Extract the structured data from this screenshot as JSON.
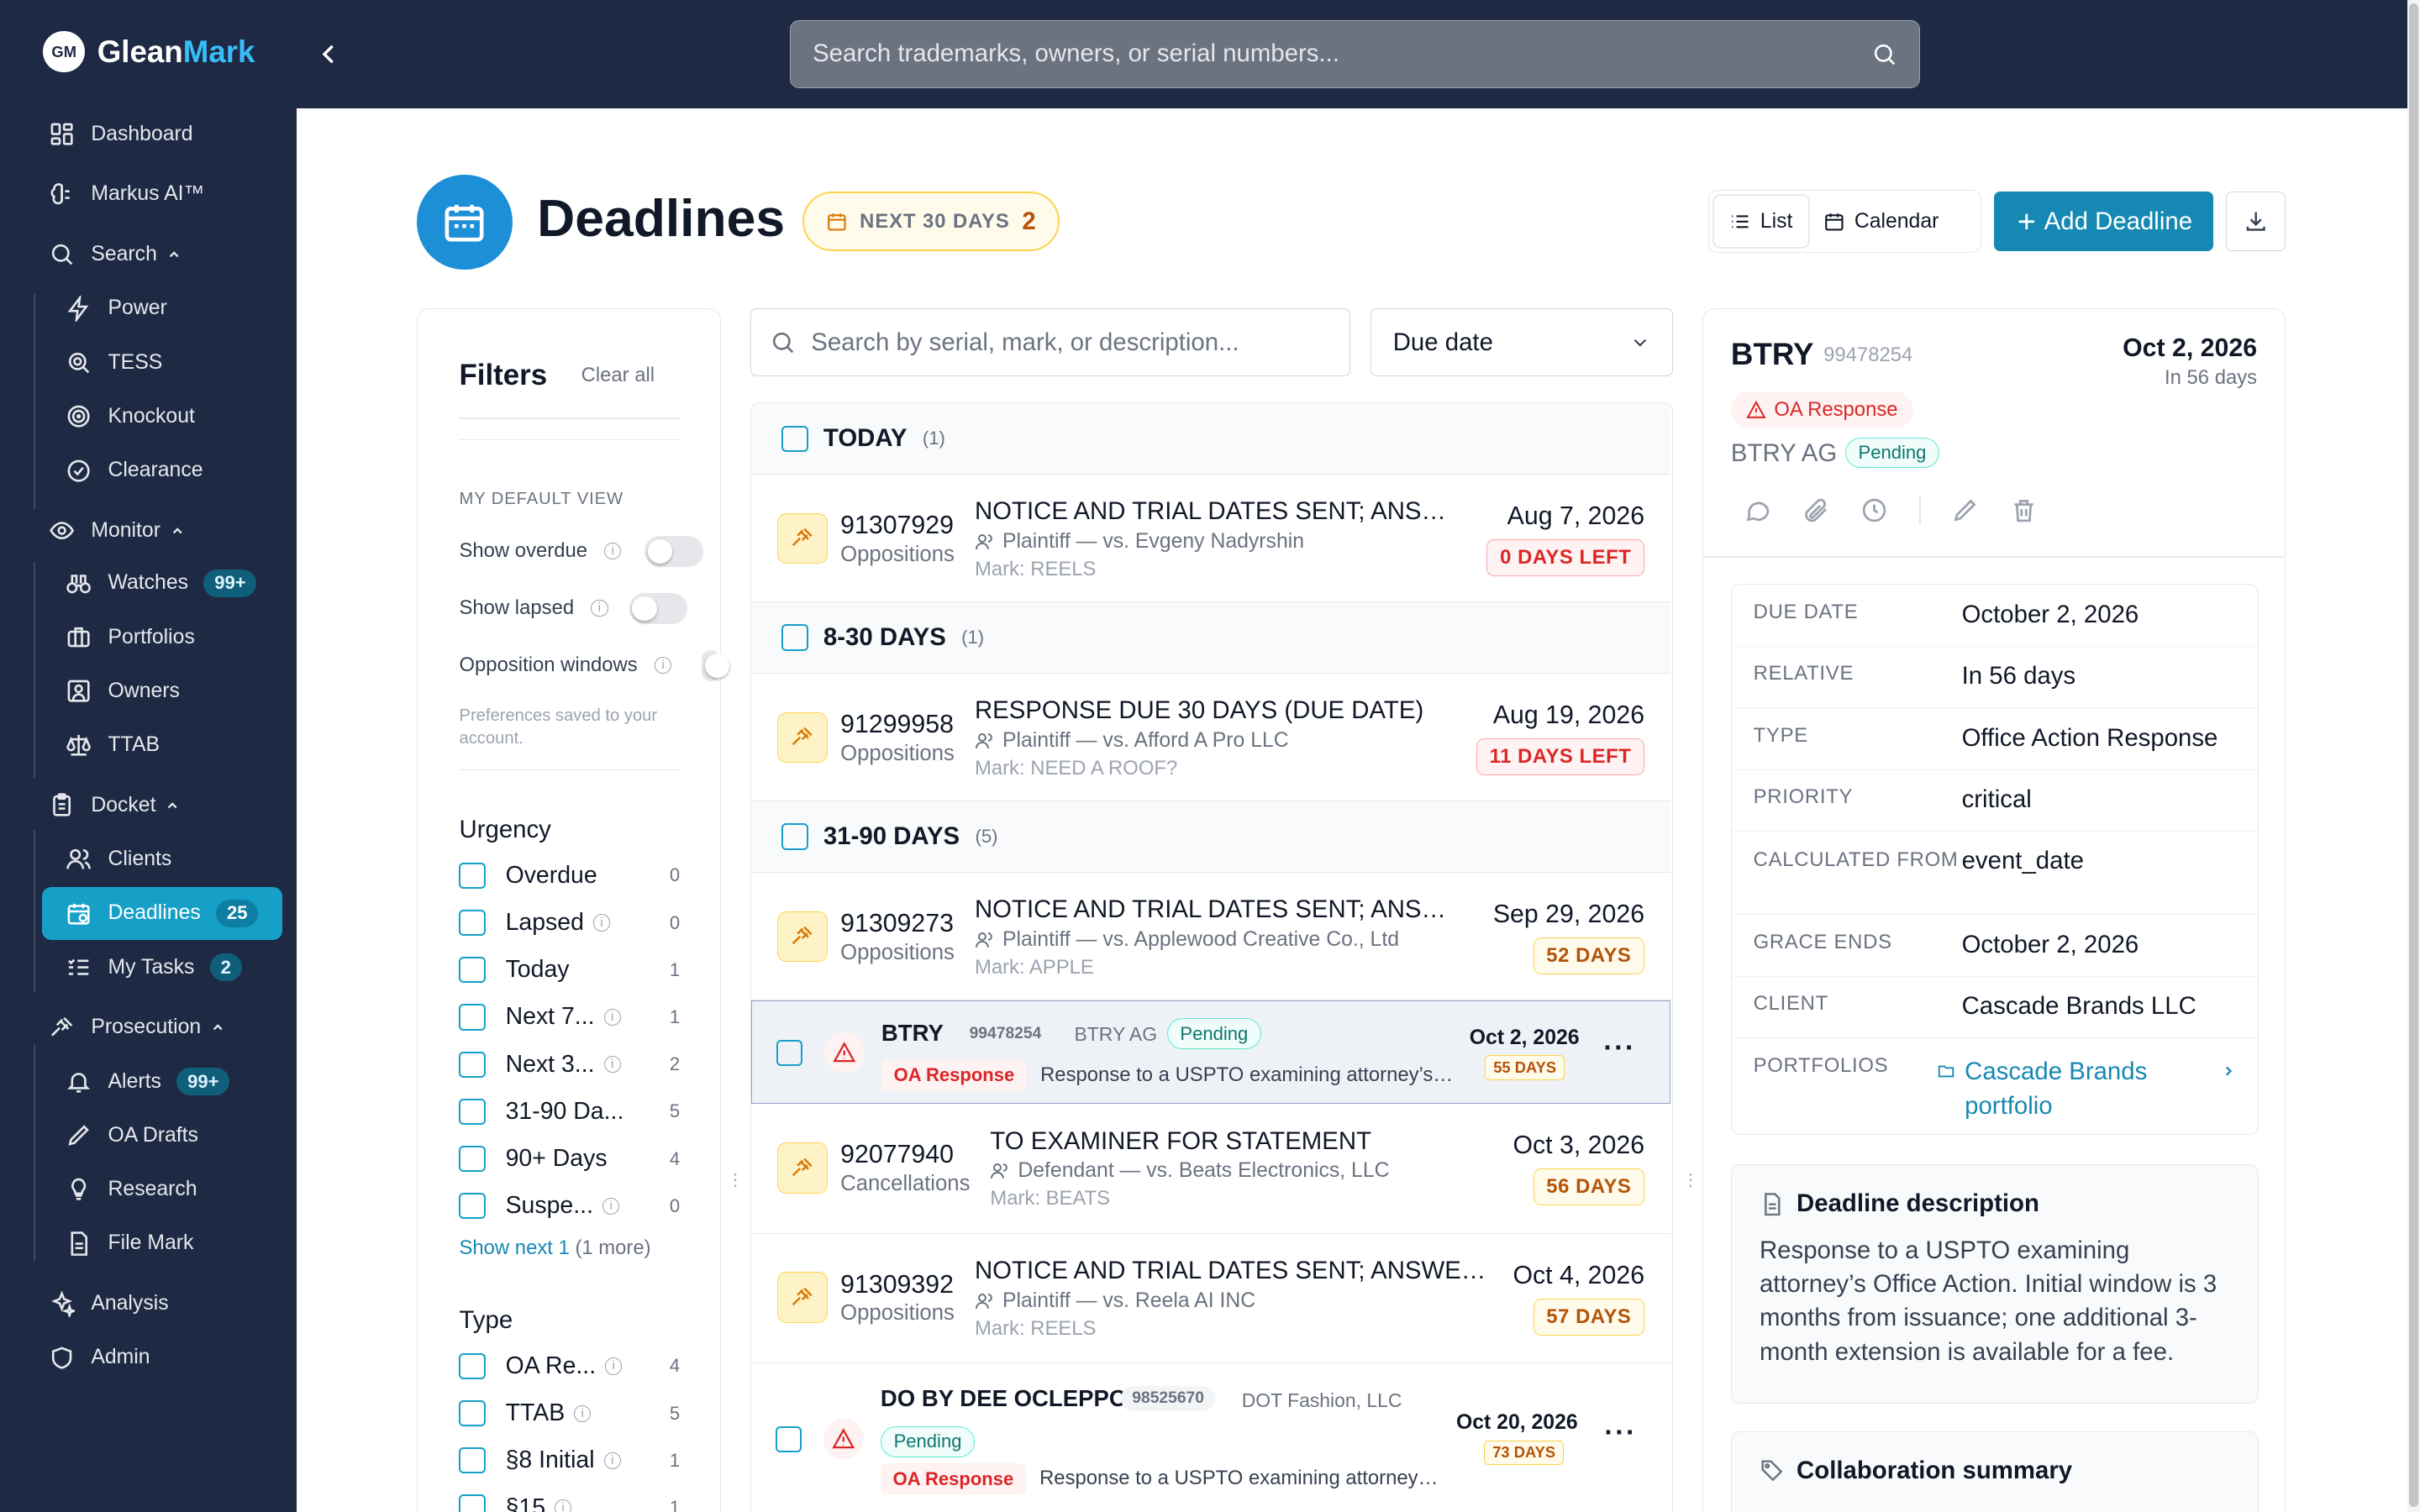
{
  "app": {
    "logo_initials": "GM",
    "brand_a": "Glean",
    "brand_b": "Mark"
  },
  "topbar": {
    "search_placeholder": "Search trademarks, owners, or serial numbers..."
  },
  "sidebar": {
    "dashboard": "Dashboard",
    "markus": "Markus AI™",
    "search": "Search",
    "power": "Power",
    "tess": "TESS",
    "knockout": "Knockout",
    "clearance": "Clearance",
    "monitor": "Monitor",
    "watches": "Watches",
    "watches_badge": "99+",
    "portfolios": "Portfolios",
    "owners": "Owners",
    "ttab": "TTAB",
    "docket": "Docket",
    "clients": "Clients",
    "deadlines": "Deadlines",
    "deadlines_badge": "25",
    "mytasks": "My Tasks",
    "mytasks_badge": "2",
    "prosecution": "Prosecution",
    "alerts": "Alerts",
    "alerts_badge": "99+",
    "oadrafts": "OA Drafts",
    "research": "Research",
    "filemark": "File Mark",
    "analysis": "Analysis",
    "admin": "Admin"
  },
  "header": {
    "title": "Deadlines",
    "range_label": "NEXT 30 DAYS",
    "range_count": "2",
    "list_label": "List",
    "calendar_label": "Calendar",
    "add_label": "Add Deadline"
  },
  "filters": {
    "title": "Filters",
    "clear": "Clear all",
    "default_view": "MY DEFAULT VIEW",
    "show_overdue": "Show overdue",
    "show_lapsed": "Show lapsed",
    "opposition_windows": "Opposition windows",
    "saved_note": "Preferences saved to your account.",
    "urgency_title": "Urgency",
    "urgency": [
      {
        "label": "Overdue",
        "count": "0"
      },
      {
        "label": "Lapsed",
        "count": "0"
      },
      {
        "label": "Today",
        "count": "1"
      },
      {
        "label": "Next 7...",
        "count": "1"
      },
      {
        "label": "Next 3...",
        "count": "2"
      },
      {
        "label": "31-90 Da...",
        "count": "5"
      },
      {
        "label": "90+ Days",
        "count": "4"
      },
      {
        "label": "Suspe...",
        "count": "0"
      }
    ],
    "show_next": "Show next 1",
    "show_more": "(1 more)",
    "type_title": "Type",
    "types": [
      {
        "label": "OA Re...",
        "count": "4"
      },
      {
        "label": "TTAB",
        "count": "5"
      },
      {
        "label": "§8 Initial",
        "count": "1"
      },
      {
        "label": "§15",
        "count": "1"
      }
    ]
  },
  "list": {
    "search_placeholder": "Search by serial, mark, or description...",
    "sort_value": "Due date",
    "groups": [
      {
        "title": "TODAY",
        "count": "(1)"
      },
      {
        "title": "8-30 DAYS",
        "count": "(1)"
      },
      {
        "title": "31-90 DAYS",
        "count": "(5)"
      }
    ],
    "rows": [
      {
        "serial": "91307929",
        "cat": "Oppositions",
        "title": "NOTICE AND TRIAL DATES SENT; ANSWER DUE",
        "party": "Plaintiff — vs. Evgeny Nadyrshin",
        "mark": "Mark: REELS",
        "date": "Aug 7, 2026",
        "left": "0 DAYS LEFT"
      },
      {
        "serial": "91299958",
        "cat": "Oppositions",
        "title": "RESPONSE DUE 30 DAYS (DUE DATE)",
        "party": "Plaintiff — vs. Afford A Pro LLC",
        "mark": "Mark: NEED A ROOF?",
        "date": "Aug 19, 2026",
        "left": "11 DAYS LEFT"
      },
      {
        "serial": "91309273",
        "cat": "Oppositions",
        "title": "NOTICE AND TRIAL DATES SENT; ANSWER DUE",
        "party": "Plaintiff — vs. Applewood Creative Co., Ltd",
        "mark": "Mark: APPLE",
        "date": "Sep 29, 2026",
        "left": "52 DAYS"
      },
      {
        "mark": "BTRY",
        "serial": "99478254",
        "owner": "BTRY AG",
        "status": "Pending",
        "type": "OA Response",
        "desc": "Response to a USPTO examining attorney’s Office Action.",
        "date": "Oct 2, 2026",
        "left": "55 DAYS"
      },
      {
        "serial": "92077940",
        "cat": "Cancellations",
        "title": "TO EXAMINER FOR STATEMENT",
        "party": "Defendant — vs. Beats Electronics, LLC",
        "mark": "Mark: BEATS",
        "date": "Oct 3, 2026",
        "left": "56 DAYS"
      },
      {
        "serial": "91309392",
        "cat": "Oppositions",
        "title": "NOTICE AND TRIAL DATES SENT; ANSWER DUE",
        "party": "Plaintiff — vs. Reela AI INC",
        "mark": "Mark: REELS",
        "date": "Oct 4, 2026",
        "left": "57 DAYS"
      },
      {
        "mark": "DO BY DEE OCLEPPO",
        "serial": "98525670",
        "owner": "DOT Fashion, LLC",
        "status": "Pending",
        "type": "OA Response",
        "desc": "Response to a USPTO examining attorney’s Office Action.",
        "date": "Oct 20, 2026",
        "left": "73 DAYS"
      }
    ]
  },
  "detail": {
    "mark": "BTRY",
    "serial": "99478254",
    "date": "Oct 2, 2026",
    "relative": "In 56 days",
    "type_badge": "OA Response",
    "owner": "BTRY AG",
    "status": "Pending",
    "fields": [
      {
        "k": "DUE DATE",
        "v": "October 2, 2026"
      },
      {
        "k": "RELATIVE",
        "v": "In 56 days"
      },
      {
        "k": "TYPE",
        "v": "Office Action Response"
      },
      {
        "k": "PRIORITY",
        "v": "critical"
      },
      {
        "k": "CALCULATED FROM",
        "v": "event_date"
      },
      {
        "k": "GRACE ENDS",
        "v": "October 2, 2026"
      },
      {
        "k": "CLIENT",
        "v": "Cascade Brands LLC"
      },
      {
        "k": "PORTFOLIOS",
        "v": "Cascade Brands portfolio"
      }
    ],
    "desc_title": "Deadline description",
    "desc_text": "Response to a USPTO examining attorney’s Office Action. Initial window is 3 months from issuance; one additional 3-month extension is available for a fee.",
    "collab_title": "Collaboration summary"
  }
}
